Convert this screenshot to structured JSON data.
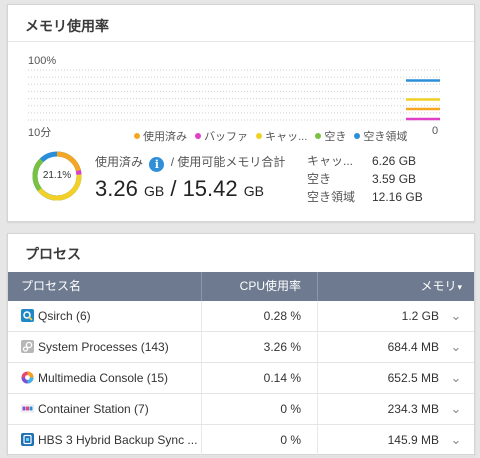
{
  "memory": {
    "title": "メモリ使用率",
    "y_max_label": "100%",
    "x_left_label": "10分",
    "x_right_label": "0",
    "legend": [
      {
        "label": "使用済み",
        "color": "#f5a623"
      },
      {
        "label": "バッファ",
        "color": "#e040c8"
      },
      {
        "label": "キャッ...",
        "color": "#f2d027"
      },
      {
        "label": "空き",
        "color": "#7ac142"
      },
      {
        "label": "空き領域",
        "color": "#2a8fd8"
      }
    ],
    "donut_percent": "21.1%",
    "used_label": "使用済み",
    "info_icon": "i",
    "total_label": "/ 使用可能メモリ合計",
    "used_value": "3.26",
    "used_unit": "GB",
    "separator": "/",
    "total_value": "15.42",
    "total_unit": "GB",
    "details": [
      {
        "label": "キャッ...",
        "value": "6.26 GB"
      },
      {
        "label": "空き",
        "value": "3.59 GB"
      },
      {
        "label": "空き領域",
        "value": "12.16 GB"
      }
    ]
  },
  "chart_data": {
    "type": "line",
    "x_range_labels": [
      "10分",
      "0"
    ],
    "ylim": [
      0,
      100
    ],
    "y_tick_label": "100%",
    "series": [
      {
        "name": "空き領域",
        "color": "#2a8fd8",
        "value": 79
      },
      {
        "name": "キャッ...",
        "color": "#f2d027",
        "value": 41
      },
      {
        "name": "使用済み",
        "color": "#f5a623",
        "value": 22
      },
      {
        "name": "バッファ",
        "color": "#e040c8",
        "value": 2
      }
    ]
  },
  "processes": {
    "title": "プロセス",
    "columns": {
      "name": "プロセス名",
      "cpu": "CPU使用率",
      "mem": "メモリ"
    },
    "sort_icon": "▾",
    "rows": [
      {
        "name": "Qsirch (6)",
        "cpu": "0.28 %",
        "mem": "1.2 GB",
        "icon": "qsirch-icon"
      },
      {
        "name": "System Processes (143)",
        "cpu": "3.26 %",
        "mem": "684.4 MB",
        "icon": "system-processes-icon"
      },
      {
        "name": "Multimedia Console (15)",
        "cpu": "0.14 %",
        "mem": "652.5 MB",
        "icon": "multimedia-console-icon"
      },
      {
        "name": "Container Station (7)",
        "cpu": "0 %",
        "mem": "234.3 MB",
        "icon": "container-station-icon"
      },
      {
        "name": "HBS 3 Hybrid Backup Sync ...",
        "cpu": "0 %",
        "mem": "145.9 MB",
        "icon": "hbs3-icon"
      }
    ],
    "expand_icon": "⌄"
  }
}
